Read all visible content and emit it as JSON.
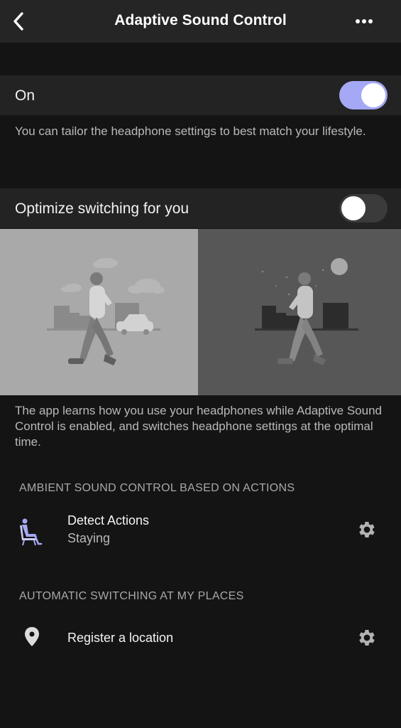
{
  "header": {
    "title": "Adaptive Sound Control",
    "back_icon": "chevron-left-icon",
    "more_icon": "more-horizontal-icon"
  },
  "adaptive_toggle": {
    "label": "On",
    "state": "on",
    "description": "You can tailor the headphone settings to best match your lifestyle."
  },
  "optimize_toggle": {
    "label": "Optimize switching for you",
    "state": "off",
    "description": "The app learns how you use your headphones while Adaptive Sound Control is enabled, and switches headphone settings at the optimal time."
  },
  "ambient_section": {
    "header": "AMBIENT SOUND CONTROL BASED ON ACTIONS",
    "item": {
      "title": "Detect Actions",
      "subtitle": "Staying",
      "icon": "sitting-person-icon",
      "settings_icon": "gear-icon"
    }
  },
  "places_section": {
    "header": "AUTOMATIC SWITCHING AT MY PLACES",
    "item": {
      "title": "Register a location",
      "icon": "location-pin-icon",
      "settings_icon": "gear-icon"
    }
  },
  "colors": {
    "accent": "#a5a8f4",
    "background": "#141414",
    "surface": "#232323",
    "secondary_text": "#b9b9b9"
  }
}
